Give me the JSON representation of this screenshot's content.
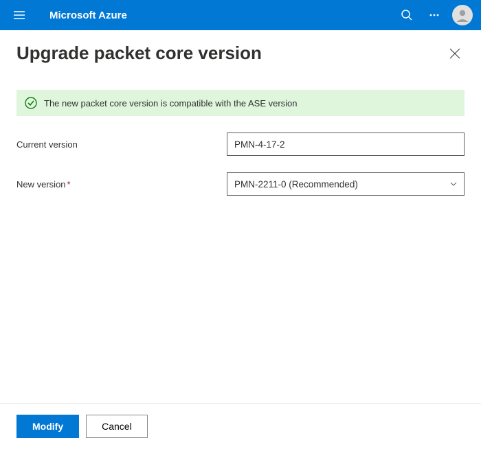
{
  "topbar": {
    "brand": "Microsoft Azure"
  },
  "page": {
    "title": "Upgrade packet core version"
  },
  "status": {
    "message": "The new packet core version is compatible with the ASE version"
  },
  "form": {
    "current_version_label": "Current version",
    "current_version_value": "PMN-4-17-2",
    "new_version_label": "New version",
    "new_version_value": "PMN-2211-0 (Recommended)"
  },
  "footer": {
    "primary": "Modify",
    "secondary": "Cancel"
  }
}
